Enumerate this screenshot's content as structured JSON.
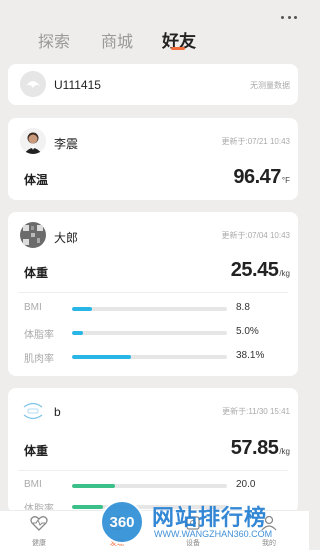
{
  "tabs": [
    {
      "label": "探索",
      "active": false
    },
    {
      "label": "商城",
      "active": false
    },
    {
      "label": "好友",
      "active": true
    }
  ],
  "colors": {
    "accent": "#f26b3a",
    "bmi_bar": "#29b6e6",
    "fat_bar": "#29b6e6",
    "muscle_bar": "#29b6e6",
    "bmi_bar_green": "#3cc08a"
  },
  "self_card": {
    "username": "U111415",
    "status": "无测量数据"
  },
  "friend1": {
    "name": "李震",
    "updated": "更新于:07/21 10:43",
    "metric_label": "体温",
    "metric_value": "96.47",
    "metric_unit": "°F"
  },
  "friend2": {
    "name": "大郎",
    "updated": "更新于:07/04 10:43",
    "metric_label": "体重",
    "metric_value": "25.45",
    "metric_unit": "/kg",
    "rows": [
      {
        "label": "BMI",
        "value": "8.8",
        "level": 0.13
      },
      {
        "label": "体脂率",
        "value": "5.0%",
        "level": 0.07
      },
      {
        "label": "肌肉率",
        "value": "38.1%",
        "level": 0.38
      }
    ]
  },
  "friend3": {
    "name": "b",
    "updated": "更新于:11/30 15:41",
    "metric_label": "体重",
    "metric_value": "57.85",
    "metric_unit": "/kg",
    "rows": [
      {
        "label": "BMI",
        "value": "20.0",
        "level": 0.28
      },
      {
        "label": "体脂率",
        "value": "",
        "level": 0.2
      }
    ]
  },
  "bottom_nav": [
    {
      "label": "健康",
      "icon": "heart-icon",
      "active": false
    },
    {
      "label": "发现",
      "icon": "compass-icon",
      "active": true
    },
    {
      "label": "设备",
      "icon": "device-icon",
      "active": false
    },
    {
      "label": "我的",
      "icon": "user-icon",
      "active": false
    }
  ],
  "watermark": {
    "logo_text": "360",
    "title": "网站排行榜",
    "url": "WWW.WANGZHAN360.COM"
  }
}
